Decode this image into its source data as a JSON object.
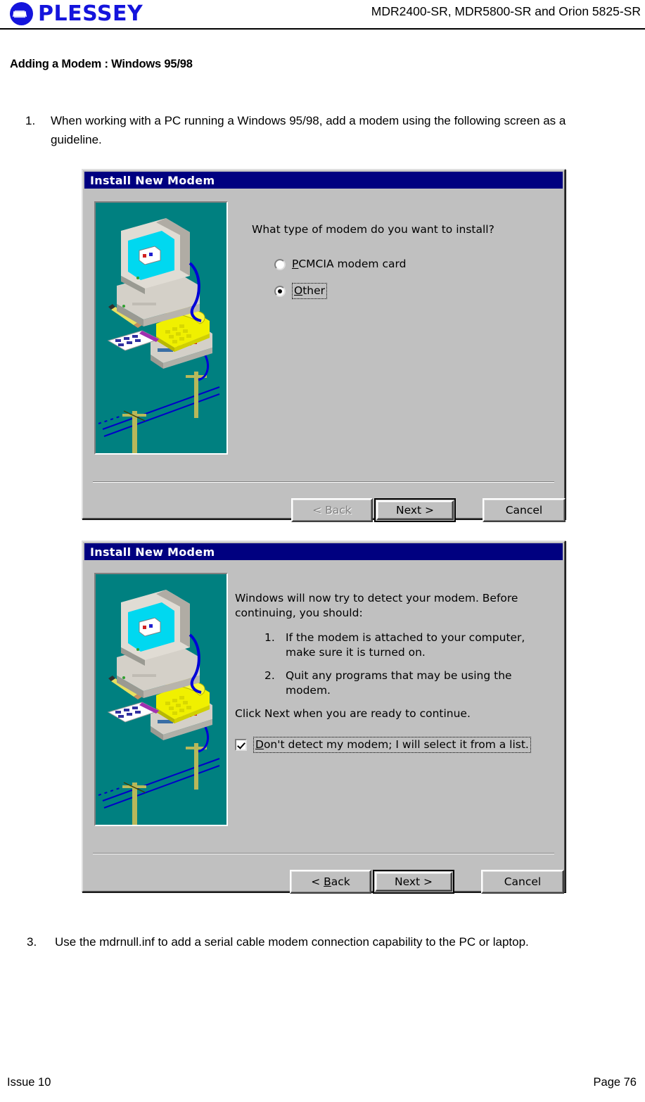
{
  "header": {
    "logo_text": "PLESSEY",
    "logo_icon": "plessey-waveform-circle-icon",
    "title": "MDR2400-SR, MDR5800-SR and Orion 5825-SR"
  },
  "section": {
    "title": "Adding a Modem : Windows 95/98"
  },
  "steps": [
    {
      "number": "1.",
      "text": "When working with a PC running a Windows 95/98, add a modem using the following screen as a guideline."
    },
    {
      "number": "3.",
      "text": "Use the mdrnull.inf to add a serial cable modem connection capability to the PC or laptop."
    }
  ],
  "dialog1": {
    "title": "Install New Modem",
    "prompt": "What type of modem do you want to install?",
    "options": [
      {
        "label_before": "",
        "accel": "P",
        "label_after": "CMCIA modem card",
        "checked": false,
        "focused": false
      },
      {
        "label_before": "",
        "accel": "O",
        "label_after": "ther",
        "checked": true,
        "focused": true
      }
    ],
    "buttons": {
      "back": "< Back",
      "back_accel": "B",
      "back_enabled": false,
      "next": "Next >",
      "next_default": true,
      "cancel": "Cancel"
    }
  },
  "dialog2": {
    "title": "Install New Modem",
    "intro": "Windows will now try to detect your modem.  Before continuing, you should:",
    "sub_steps": [
      {
        "number": "1.",
        "text": "If the modem is attached to your computer, make sure it is turned on."
      },
      {
        "number": "2.",
        "text": "Quit any programs that may be using the modem."
      }
    ],
    "outro": "Click Next when you are ready to continue.",
    "checkbox": {
      "accel": "D",
      "label_after": "on't detect my modem; I will select it from a list.",
      "checked": true,
      "focused": true
    },
    "buttons": {
      "back": "< Back",
      "back_accel": "B",
      "back_enabled": true,
      "next": "Next >",
      "next_default": true,
      "cancel": "Cancel"
    }
  },
  "illustration": {
    "name": "modem-telephone-pc-illustration",
    "background": "#008080",
    "monitor_screen": "#00d8f0",
    "phone": "#f0f000",
    "cable": "#0000d0",
    "case": "#c0c0c0"
  },
  "footer": {
    "issue": "Issue 10",
    "page": "Page 76"
  },
  "colors": {
    "brand_blue": "#1414dc",
    "titlebar": "#000080",
    "dialog_face": "#c0c0c0"
  }
}
